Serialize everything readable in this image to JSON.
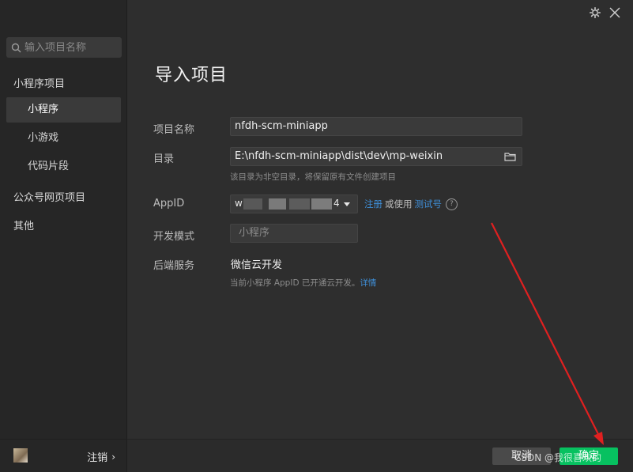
{
  "sidebar": {
    "search_placeholder": "输入项目名称",
    "groups": [
      {
        "label": "小程序项目"
      },
      {
        "label": "公众号网页项目"
      },
      {
        "label": "其他"
      }
    ],
    "items": [
      {
        "label": "小程序",
        "active": true
      },
      {
        "label": "小游戏",
        "active": false
      },
      {
        "label": "代码片段",
        "active": false
      }
    ],
    "footer": {
      "logout_label": "注销",
      "logout_chevron": "›"
    }
  },
  "window": {
    "settings_icon": "gear-icon",
    "close_icon": "close-icon"
  },
  "main": {
    "title": "导入项目",
    "fields": {
      "project_name": {
        "label": "项目名称",
        "value": "nfdh-scm-miniapp"
      },
      "directory": {
        "label": "目录",
        "value": "E:\\nfdh-scm-miniapp\\dist\\dev\\mp-weixin",
        "hint": "该目录为非空目录，将保留原有文件创建项目",
        "icon": "folder-icon"
      },
      "appid": {
        "label": "AppID",
        "value_prefix": "w",
        "value_suffix": "4",
        "register_link": "注册",
        "or_use": "或使用",
        "test_account_link": "测试号",
        "help_icon": "?"
      },
      "dev_mode": {
        "label": "开发模式",
        "placeholder": "小程序"
      },
      "backend": {
        "label": "后端服务",
        "value": "微信云开发",
        "hint": "当前小程序 AppID 已开通云开发。",
        "hint_link": "详情"
      }
    }
  },
  "footer": {
    "cancel_label": "取消",
    "confirm_label": "确定",
    "watermark": "CSDN @我很喜欢的"
  },
  "colors": {
    "accent_green": "#07c160",
    "link_blue": "#3f8fd8",
    "annotation_red": "#e02020"
  }
}
